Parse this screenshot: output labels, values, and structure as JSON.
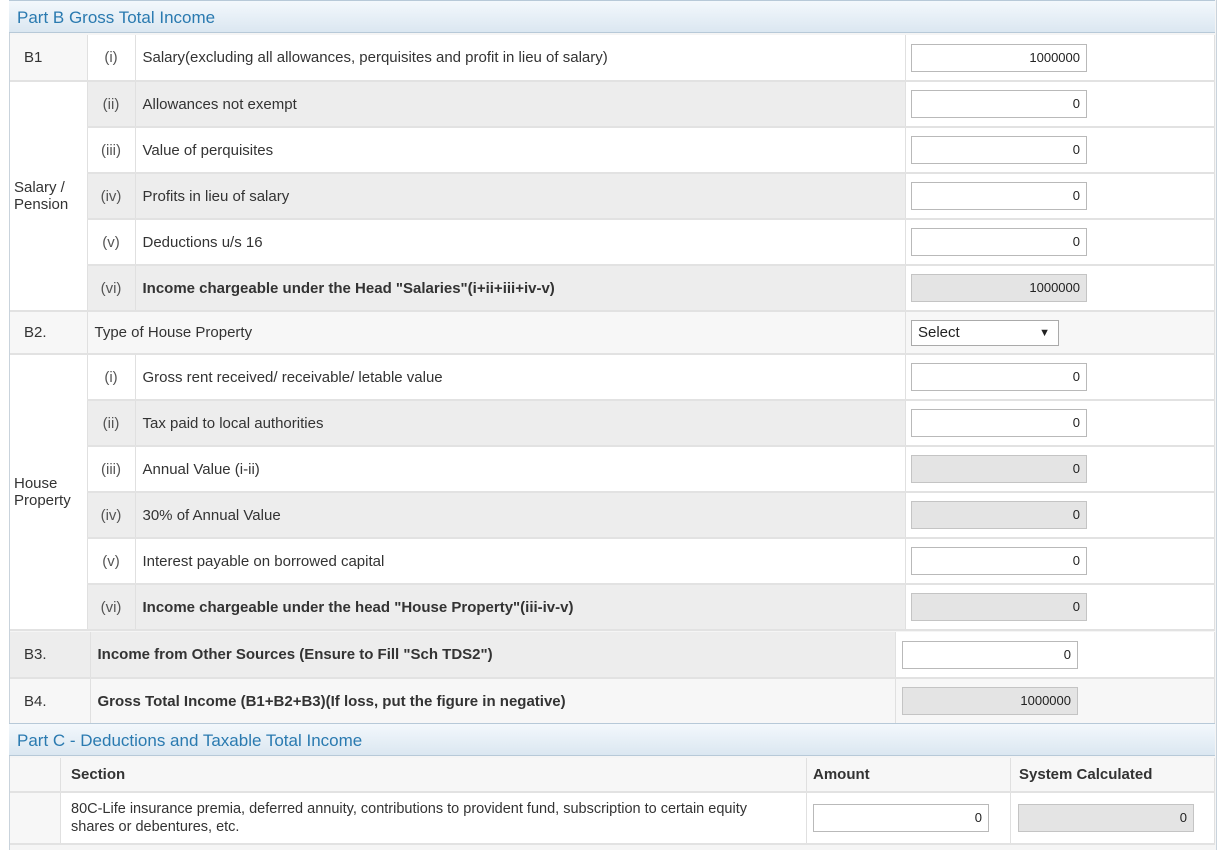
{
  "part_b": {
    "title": "Part B Gross Total Income",
    "b1": {
      "code": "B1",
      "group_label": "Salary / Pension",
      "rows": [
        {
          "num": "(i)",
          "desc": "Salary(excluding all allowances, perquisites and profit in lieu of salary)",
          "value": "1000000",
          "readonly": false,
          "bold": false
        },
        {
          "num": "(ii)",
          "desc": "Allowances not exempt",
          "value": "0",
          "readonly": false,
          "bold": false
        },
        {
          "num": "(iii)",
          "desc": "Value of perquisites",
          "value": "0",
          "readonly": false,
          "bold": false
        },
        {
          "num": "(iv)",
          "desc": "Profits in lieu of salary",
          "value": "0",
          "readonly": false,
          "bold": false
        },
        {
          "num": "(v)",
          "desc": "Deductions u/s 16",
          "value": "0",
          "readonly": false,
          "bold": false
        },
        {
          "num": "(vi)",
          "desc": "Income chargeable under the Head \"Salaries\"(i+ii+iii+iv-v)",
          "value": "1000000",
          "readonly": true,
          "bold": true
        }
      ]
    },
    "b2": {
      "code": "B2.",
      "type_label": "Type of House Property",
      "type_value": "Select",
      "group_label": "House Property",
      "rows": [
        {
          "num": "(i)",
          "desc": "Gross rent received/ receivable/ letable value",
          "value": "0",
          "readonly": false,
          "bold": false
        },
        {
          "num": "(ii)",
          "desc": "Tax paid to local authorities",
          "value": "0",
          "readonly": false,
          "bold": false
        },
        {
          "num": "(iii)",
          "desc": "Annual Value (i-ii)",
          "value": "0",
          "readonly": true,
          "bold": false
        },
        {
          "num": "(iv)",
          "desc": "30% of Annual Value",
          "value": "0",
          "readonly": true,
          "bold": false
        },
        {
          "num": "(v)",
          "desc": "Interest payable on borrowed capital",
          "value": "0",
          "readonly": false,
          "bold": false
        },
        {
          "num": "(vi)",
          "desc": "Income chargeable under the head \"House Property\"(iii-iv-v)",
          "value": "0",
          "readonly": true,
          "bold": true
        }
      ]
    },
    "b3": {
      "code": "B3.",
      "desc": "Income from Other Sources (Ensure to Fill \"Sch TDS2\")",
      "value": "0"
    },
    "b4": {
      "code": "B4.",
      "desc": "Gross Total Income (B1+B2+B3)(If loss, put the figure in negative)",
      "value": "1000000"
    }
  },
  "part_c": {
    "title": "Part C - Deductions and Taxable Total Income",
    "headers": {
      "section": "Section",
      "amount": "Amount",
      "system": "System Calculated"
    },
    "rows": [
      {
        "desc": "80C-Life insurance premia, deferred annuity, contributions to provident fund, subscription to certain equity shares or debentures, etc.",
        "amount": "0",
        "system": "0"
      }
    ]
  }
}
